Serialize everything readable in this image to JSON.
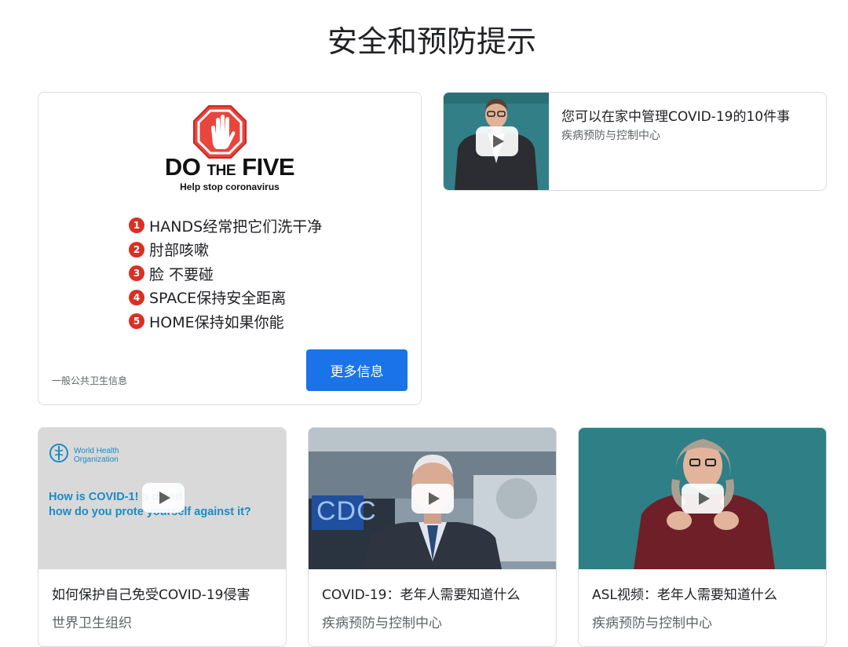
{
  "page": {
    "title": "安全和预防提示"
  },
  "do_the_five": {
    "logo": {
      "do": "DO",
      "the": "THE",
      "five": "FIVE"
    },
    "subtitle": "Help stop coronavirus",
    "items": [
      {
        "num": "1",
        "text": "HANDS经常把它们洗干净"
      },
      {
        "num": "2",
        "text": "肘部咳嗽"
      },
      {
        "num": "3",
        "text": "脸 不要碰"
      },
      {
        "num": "4",
        "text": "SPACE保持安全距离"
      },
      {
        "num": "5",
        "text": "HOME保持如果你能"
      }
    ],
    "source": "一般公共卫生信息",
    "button_label": "更多信息",
    "accent": "#d93025",
    "button_color": "#1a73e8"
  },
  "featured_video": {
    "title": "您可以在家中管理COVID-19的10件事",
    "source": "疾病预防与控制中心"
  },
  "videos": [
    {
      "title": "如何保护自己免受COVID-19侵害",
      "source": "世界卫生组织",
      "thumb_text": {
        "org_line1": "World Health",
        "org_line2": "Organization",
        "line1": "How is COVID-1! p d and",
        "line2": "how do you prote yourself against it?"
      }
    },
    {
      "title": "COVID-19：老年人需要知道什么",
      "source": "疾病预防与控制中心",
      "thumb_text": {
        "sign": "CDC"
      }
    },
    {
      "title": "ASL视频：老年人需要知道什么",
      "source": "疾病预防与控制中心"
    }
  ]
}
